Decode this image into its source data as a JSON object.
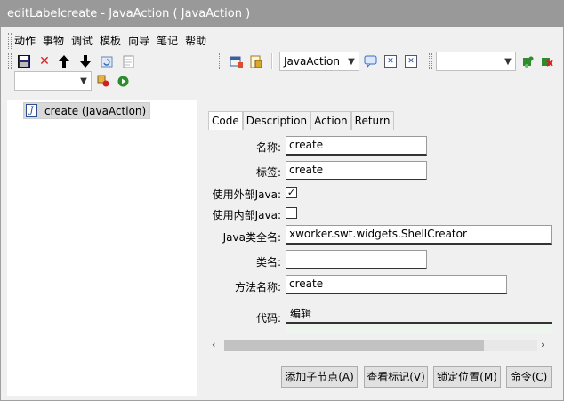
{
  "window": {
    "title": "editLabelcreate - JavaAction ( JavaAction )"
  },
  "menu": [
    "动作",
    "事物",
    "调试",
    "模板",
    "向导",
    "笔记",
    "帮助"
  ],
  "toolbar": {
    "class_combo_value": "JavaAction",
    "right_combo_value": "",
    "left_combo_value": ""
  },
  "tree": {
    "item_label": "create (JavaAction)"
  },
  "tabs": [
    "Code",
    "Description",
    "Action",
    "Return"
  ],
  "form": {
    "name_label": "名称:",
    "name_value": "create",
    "label_label": "标签:",
    "label_value": "create",
    "use_external_java_label": "使用外部Java:",
    "use_external_java_checked": "✓",
    "use_internal_java_label": "使用内部Java:",
    "java_class_label": "Java类全名:",
    "java_class_value": "xworker.swt.widgets.ShellCreator",
    "class_name_label": "类名:",
    "class_name_value": "",
    "method_label": "方法名称:",
    "method_value": "create",
    "code_label": "代码:",
    "code_edit_link": "编辑"
  },
  "buttons": {
    "add_child": "添加子节点(A)",
    "view_marks": "查看标记(V)",
    "lock_position": "锁定位置(M)",
    "command": "命令(C)"
  },
  "colors": {
    "title_bar": "#999999",
    "accent_green": "#2e8b2e",
    "accent_red": "#d42020"
  }
}
